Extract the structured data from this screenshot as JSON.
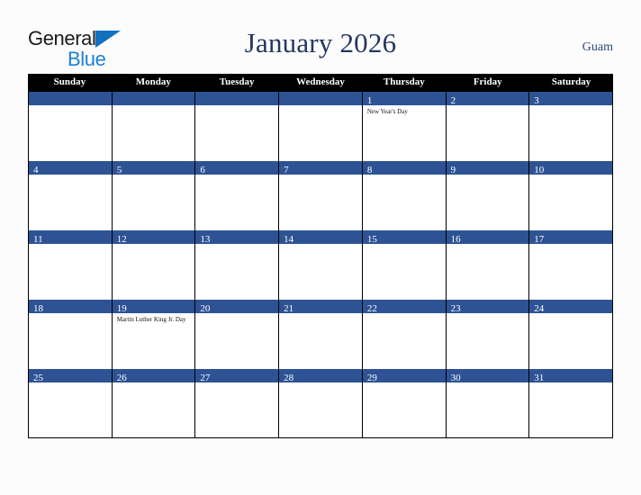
{
  "brand": {
    "name_part1": "General",
    "name_part2": "Blue",
    "triangle_icon": "triangle-icon",
    "accent_blue": "#1e7fd4",
    "triangle_blue": "#1271bf"
  },
  "header": {
    "title": "January 2026",
    "region": "Guam",
    "title_color": "#24385f"
  },
  "calendar": {
    "month": "January",
    "year": "2026",
    "weekday_headers": [
      "Sunday",
      "Monday",
      "Tuesday",
      "Wednesday",
      "Thursday",
      "Friday",
      "Saturday"
    ],
    "header_bg": "#000000",
    "daybar_color": "#2e5395",
    "grid_line_color": "#000000",
    "weeks": [
      [
        {
          "day": "",
          "events": []
        },
        {
          "day": "",
          "events": []
        },
        {
          "day": "",
          "events": []
        },
        {
          "day": "",
          "events": []
        },
        {
          "day": "1",
          "events": [
            "New Year's Day"
          ]
        },
        {
          "day": "2",
          "events": []
        },
        {
          "day": "3",
          "events": []
        }
      ],
      [
        {
          "day": "4",
          "events": []
        },
        {
          "day": "5",
          "events": []
        },
        {
          "day": "6",
          "events": []
        },
        {
          "day": "7",
          "events": []
        },
        {
          "day": "8",
          "events": []
        },
        {
          "day": "9",
          "events": []
        },
        {
          "day": "10",
          "events": []
        }
      ],
      [
        {
          "day": "11",
          "events": []
        },
        {
          "day": "12",
          "events": []
        },
        {
          "day": "13",
          "events": []
        },
        {
          "day": "14",
          "events": []
        },
        {
          "day": "15",
          "events": []
        },
        {
          "day": "16",
          "events": []
        },
        {
          "day": "17",
          "events": []
        }
      ],
      [
        {
          "day": "18",
          "events": []
        },
        {
          "day": "19",
          "events": [
            "Martin Luther King Jr. Day"
          ]
        },
        {
          "day": "20",
          "events": []
        },
        {
          "day": "21",
          "events": []
        },
        {
          "day": "22",
          "events": []
        },
        {
          "day": "23",
          "events": []
        },
        {
          "day": "24",
          "events": []
        }
      ],
      [
        {
          "day": "25",
          "events": []
        },
        {
          "day": "26",
          "events": []
        },
        {
          "day": "27",
          "events": []
        },
        {
          "day": "28",
          "events": []
        },
        {
          "day": "29",
          "events": []
        },
        {
          "day": "30",
          "events": []
        },
        {
          "day": "31",
          "events": []
        }
      ]
    ]
  }
}
